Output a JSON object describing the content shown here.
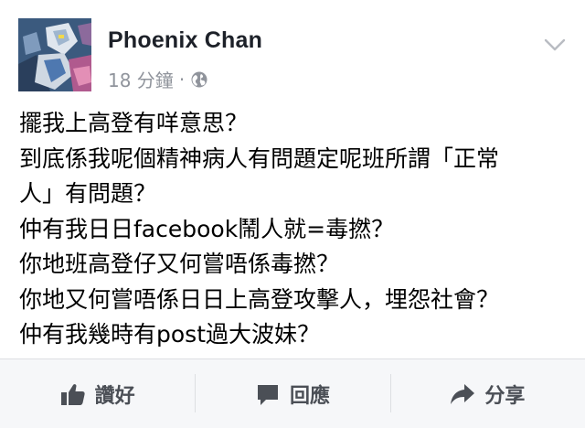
{
  "post": {
    "author": "Phoenix Chan",
    "timestamp": "18 分鐘",
    "separator": "·",
    "privacy_icon": "globe-icon",
    "menu_icon": "chevron-down-icon",
    "lines": [
      "擺我上高登有咩意思？",
      "到底係我呢個精神病人有問題定呢班所謂「正常",
      "人」有問題？",
      "仲有我日日facebook鬧人就=毒撚？",
      "你地班高登仔又何嘗唔係毒撚？",
      "你地又何嘗唔係日日上高登攻擊人，埋怨社會？",
      "仲有我幾時有post過大波妹？"
    ]
  },
  "actions": {
    "like": {
      "label": "讚好",
      "icon": "thumbs-up-icon"
    },
    "comment": {
      "label": "回應",
      "icon": "comment-icon"
    },
    "share": {
      "label": "分享",
      "icon": "share-icon"
    }
  },
  "colors": {
    "author": "#1d2129",
    "meta": "#90949c",
    "action_text": "#4b4f56",
    "action_bar_bg": "#f6f7f9",
    "divider": "#dddfe2"
  }
}
